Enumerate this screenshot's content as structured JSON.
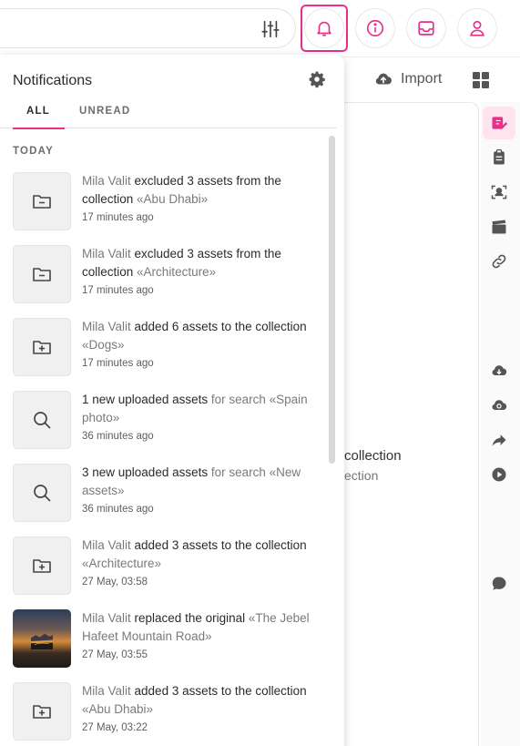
{
  "topbar": {
    "filter_icon": "sliders-icon",
    "buttons": [
      "bell-icon",
      "info-icon",
      "inbox-icon",
      "user-icon"
    ],
    "accent_color": "#e8308a"
  },
  "background": {
    "import_label": "Import",
    "line1": "collection",
    "line2": "ection"
  },
  "notifications": {
    "title": "Notifications",
    "tabs": {
      "all": "ALL",
      "unread": "UNREAD"
    },
    "section": "TODAY",
    "items": [
      {
        "icon": "folder-minus-icon",
        "user": "Mila Valit",
        "action": "excluded 3 assets from the collection",
        "target": "«Abu Dhabi»",
        "time": "17 minutes ago"
      },
      {
        "icon": "folder-minus-icon",
        "user": "Mila Valit",
        "action": "excluded 3 assets from the collection",
        "target": "«Architecture»",
        "time": "17 minutes ago"
      },
      {
        "icon": "folder-plus-icon",
        "user": "Mila Valit",
        "action": "added 6 assets to the collection",
        "target": "«Dogs»",
        "time": "17 minutes ago"
      },
      {
        "icon": "search-icon",
        "user": "",
        "action": "1 new uploaded assets",
        "target": "for search «Spain photo»",
        "time": "36 minutes ago"
      },
      {
        "icon": "search-icon",
        "user": "",
        "action": "3 new uploaded assets",
        "target": "for search «New assets»",
        "time": "36 minutes ago"
      },
      {
        "icon": "folder-plus-icon",
        "user": "Mila Valit",
        "action": "added 3 assets to the collection",
        "target": "«Architecture»",
        "time": "27 May, 03:58"
      },
      {
        "icon": "photo-thumbnail",
        "user": "Mila Valit",
        "action": "replaced the original",
        "target": "«The Jebel Hafeet Mountain Road»",
        "time": "27 May, 03:55"
      },
      {
        "icon": "folder-plus-icon",
        "user": "Mila Valit",
        "action": "added 3 assets to the collection",
        "target": "«Abu Dhabi»",
        "time": "27 May, 03:22"
      }
    ]
  }
}
